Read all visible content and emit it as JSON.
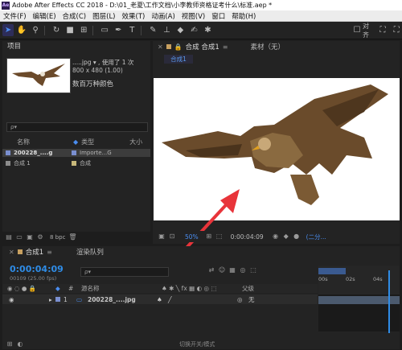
{
  "window": {
    "title": "Adobe After Effects CC 2018 - D:\\01_老夏\\工作文档\\小李教师资格证考什么\\标准.aep *",
    "logo": "Ae"
  },
  "menu": [
    "文件(F)",
    "编辑(E)",
    "合成(C)",
    "图层(L)",
    "效果(T)",
    "动画(A)",
    "视图(V)",
    "窗口",
    "帮助(H)"
  ],
  "toolbar": {
    "snap_label": "对齐"
  },
  "project": {
    "tab": "项目",
    "file_info": ".....jpg ▾ , 使用了 1 次",
    "dims": "800 x 480 (1.00)",
    "colors": "数百万种颜色",
    "search_placeholder": "ρ▾",
    "headers": {
      "name": "名称",
      "type": "类型",
      "size": "大小"
    },
    "rows": [
      {
        "name": "200228_....g",
        "type": "Importe...G",
        "color": "#7a8fd0"
      },
      {
        "name": "合成 1",
        "type": "合成",
        "color": "#c8b87a"
      }
    ],
    "bpc": "8 bpc"
  },
  "comp": {
    "tab": "合成 合成1",
    "tab_menu": "≡",
    "material_tab": "素材（无）",
    "breadcrumb": "合成1",
    "zoom": "50%",
    "timecode": "0:00:04:09",
    "resolution": "(二分..."
  },
  "timeline": {
    "tab": "合成1",
    "render_tab": "渲染队列",
    "timecode": "0:00:04:09",
    "fps": "00109 (25.00 fps)",
    "search_placeholder": "ρ▾",
    "headers": {
      "num": "#",
      "src": "源名称",
      "parent": "父级"
    },
    "layer": {
      "num": "1",
      "name": "200228_....jpg",
      "parent": "无"
    },
    "ruler": [
      "00s",
      "02s",
      "04s"
    ],
    "status": "切换开关/模式"
  },
  "colors": {
    "accent": "#2f8ce6",
    "arrow": "#e8343a"
  }
}
